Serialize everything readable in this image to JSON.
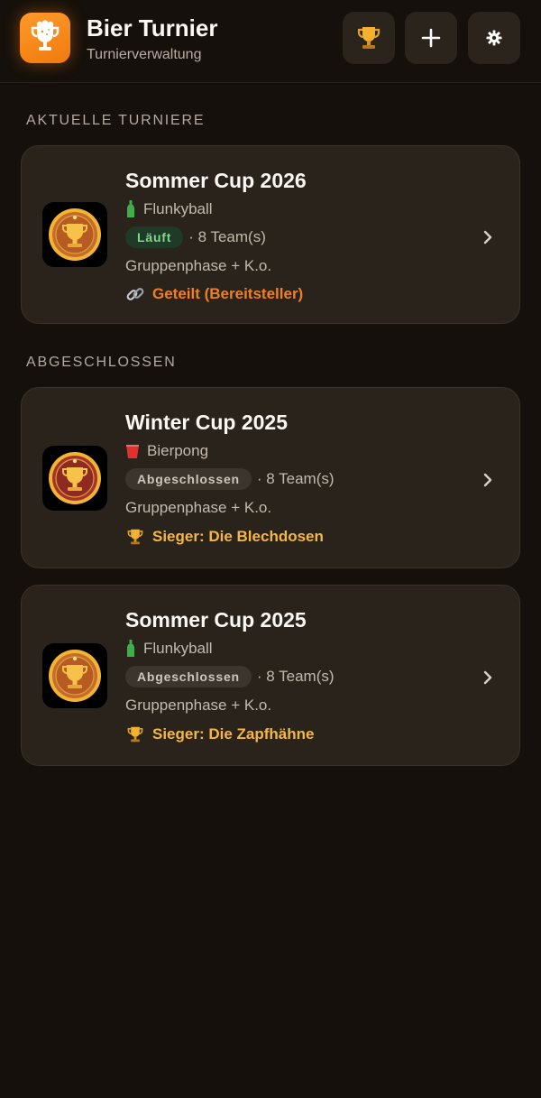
{
  "header": {
    "title": "Bier Turnier",
    "subtitle": "Turnierverwaltung",
    "buttons": {
      "trophy": "trophy-icon",
      "add": "plus-icon",
      "settings": "gear-icon"
    }
  },
  "sections": {
    "current": "AKTUELLE TURNIERE",
    "finished": "ABGESCHLOSSEN"
  },
  "tournaments": [
    {
      "name": "Sommer Cup 2026",
      "game": "Flunkyball",
      "game_icon": "bottle-icon",
      "status": "Läuft",
      "teams": "· 8 Team(s)",
      "format": "Gruppenphase + K.o.",
      "extra": "Geteilt (Bereitsteller)",
      "extra_icon": "link-icon"
    },
    {
      "name": "Winter Cup 2025",
      "game": "Bierpong",
      "game_icon": "red-cup-icon",
      "status": "Abgeschlossen",
      "teams": "· 8 Team(s)",
      "format": "Gruppenphase + K.o.",
      "extra": "Sieger: Die Blechdosen",
      "extra_icon": "trophy-icon"
    },
    {
      "name": "Sommer Cup 2025",
      "game": "Flunkyball",
      "game_icon": "bottle-icon",
      "status": "Abgeschlossen",
      "teams": "· 8 Team(s)",
      "format": "Gruppenphase + K.o.",
      "extra": "Sieger: Die Zapfhähne",
      "extra_icon": "trophy-icon"
    }
  ],
  "colors": {
    "background": "#15100b",
    "card": "#2a231c",
    "accent_orange": "#f07f22",
    "winner_gold": "#f6b740",
    "running_green": "#7fd890"
  }
}
